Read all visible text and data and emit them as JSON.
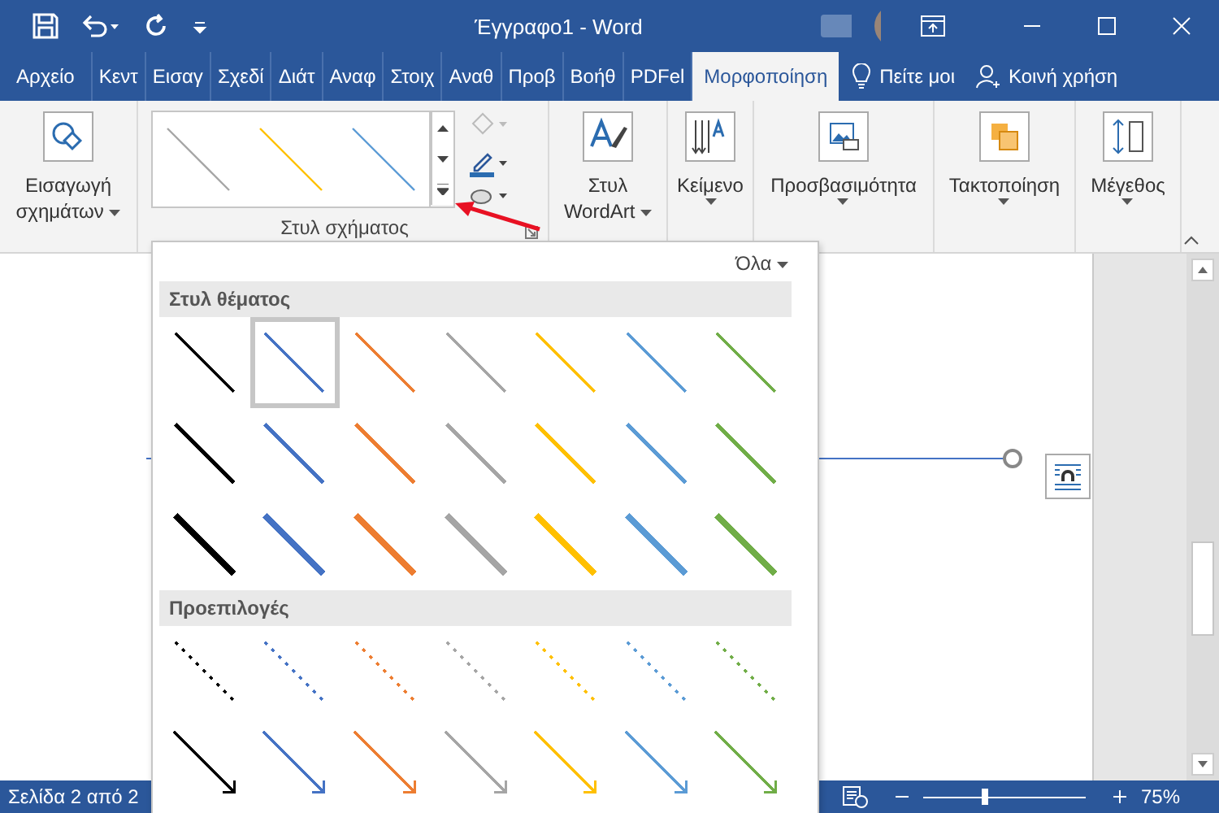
{
  "window": {
    "title": "Έγγραφο1 - Word"
  },
  "tabs": [
    {
      "label": "Αρχείο",
      "selected": false
    },
    {
      "label": "Κεντ",
      "selected": false
    },
    {
      "label": "Εισαγ",
      "selected": false
    },
    {
      "label": "Σχεδί",
      "selected": false
    },
    {
      "label": "Διάτ",
      "selected": false
    },
    {
      "label": "Αναφ",
      "selected": false
    },
    {
      "label": "Στοιχ",
      "selected": false
    },
    {
      "label": "Αναθ",
      "selected": false
    },
    {
      "label": "Προβ",
      "selected": false
    },
    {
      "label": "Βοήθ",
      "selected": false
    },
    {
      "label": "PDFel",
      "selected": false
    },
    {
      "label": "Μορφοποίηση",
      "selected": true
    }
  ],
  "tell_me": "Πείτε μοι",
  "share": "Κοινή χρήση",
  "ribbon": {
    "insert_shapes": "Εισαγωγή σχημάτων",
    "shape_styles": {
      "label": "Στυλ σχήματος"
    },
    "wordart": "Στυλ WordArt",
    "text": "Κείμενο",
    "accessibility": "Προσβασιμότητα",
    "arrange": "Τακτοποίηση",
    "size": "Μέγεθος"
  },
  "gallery": {
    "filter": "Όλα",
    "sections": [
      {
        "title": "Στυλ θέματος",
        "rows": [
          {
            "kind": "thin",
            "items": [
              {
                "color": "#000000",
                "selected": false
              },
              {
                "color": "#4472c4",
                "selected": true
              },
              {
                "color": "#ed7d31",
                "selected": false
              },
              {
                "color": "#a5a5a5",
                "selected": false
              },
              {
                "color": "#ffc000",
                "selected": false
              },
              {
                "color": "#5b9bd5",
                "selected": false
              },
              {
                "color": "#70ad47",
                "selected": false
              }
            ]
          },
          {
            "kind": "medium",
            "items": [
              {
                "color": "#000000",
                "selected": false
              },
              {
                "color": "#4472c4",
                "selected": false
              },
              {
                "color": "#ed7d31",
                "selected": false
              },
              {
                "color": "#a5a5a5",
                "selected": false
              },
              {
                "color": "#ffc000",
                "selected": false
              },
              {
                "color": "#5b9bd5",
                "selected": false
              },
              {
                "color": "#70ad47",
                "selected": false
              }
            ]
          },
          {
            "kind": "thick",
            "items": [
              {
                "color": "#000000",
                "selected": false
              },
              {
                "color": "#4472c4",
                "selected": false
              },
              {
                "color": "#ed7d31",
                "selected": false
              },
              {
                "color": "#a5a5a5",
                "selected": false
              },
              {
                "color": "#ffc000",
                "selected": false
              },
              {
                "color": "#5b9bd5",
                "selected": false
              },
              {
                "color": "#70ad47",
                "selected": false
              }
            ]
          }
        ]
      },
      {
        "title": "Προεπιλογές",
        "rows": [
          {
            "kind": "dashed",
            "items": [
              {
                "color": "#000000",
                "selected": false
              },
              {
                "color": "#4472c4",
                "selected": false
              },
              {
                "color": "#ed7d31",
                "selected": false
              },
              {
                "color": "#a5a5a5",
                "selected": false
              },
              {
                "color": "#ffc000",
                "selected": false
              },
              {
                "color": "#5b9bd5",
                "selected": false
              },
              {
                "color": "#70ad47",
                "selected": false
              }
            ]
          },
          {
            "kind": "arrow",
            "items": [
              {
                "color": "#000000",
                "selected": false
              },
              {
                "color": "#4472c4",
                "selected": false
              },
              {
                "color": "#ed7d31",
                "selected": false
              },
              {
                "color": "#a5a5a5",
                "selected": false
              },
              {
                "color": "#ffc000",
                "selected": false
              },
              {
                "color": "#5b9bd5",
                "selected": false
              },
              {
                "color": "#70ad47",
                "selected": false
              }
            ]
          }
        ]
      }
    ]
  },
  "status_bar": {
    "page": "Σελίδα 2 από 2",
    "zoom": "75%",
    "zoom_level": {
      "level": 0.38
    }
  }
}
